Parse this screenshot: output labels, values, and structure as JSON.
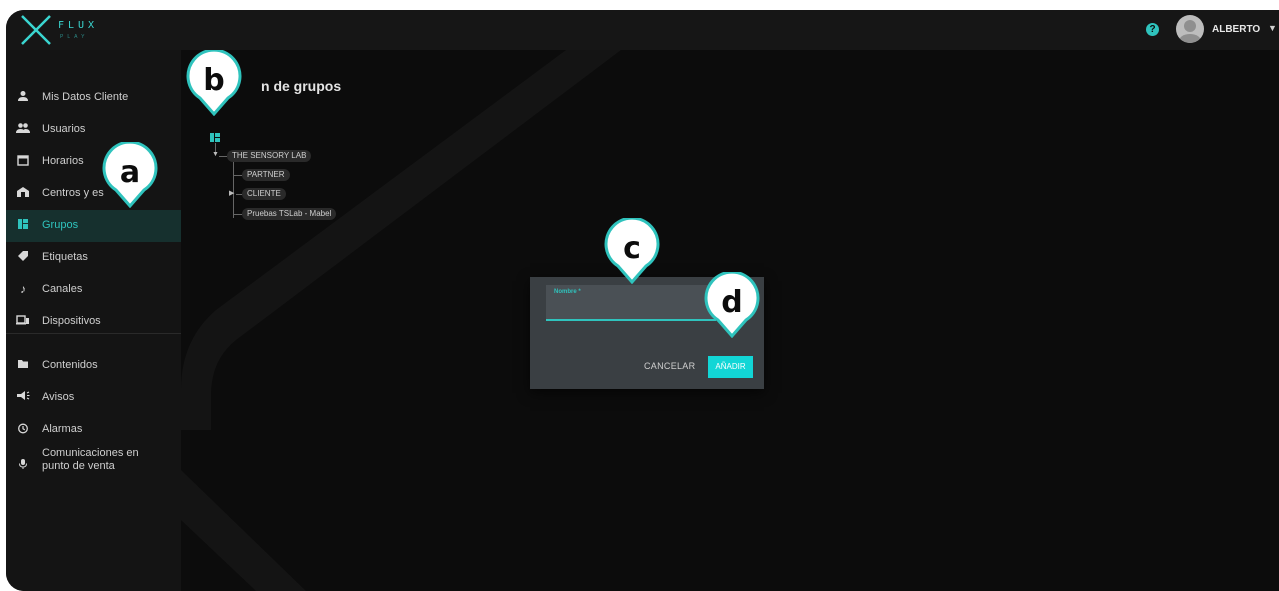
{
  "header": {
    "logo_text": "FLUX",
    "logo_sub": "PLAY",
    "help_icon": "help-icon",
    "user_name": "ALBERTO",
    "accent": "#2fc3bd"
  },
  "sidebar": {
    "items": [
      {
        "label": "Mis Datos Cliente",
        "icon": "person-icon"
      },
      {
        "label": "Usuarios",
        "icon": "users-icon"
      },
      {
        "label": "Horarios",
        "icon": "calendar-icon"
      },
      {
        "label": "Centros y es",
        "icon": "store-icon"
      },
      {
        "label": "Grupos",
        "icon": "groups-icon"
      },
      {
        "label": "Etiquetas",
        "icon": "tag-icon"
      },
      {
        "label": "Canales",
        "icon": "music-note-icon"
      },
      {
        "label": "Dispositivos",
        "icon": "devices-icon"
      },
      {
        "label": "Contenidos",
        "icon": "folder-icon"
      },
      {
        "label": "Avisos",
        "icon": "megaphone-icon"
      },
      {
        "label": "Alarmas",
        "icon": "alarm-icon"
      },
      {
        "label_line1": "Comunicaciones en",
        "label_line2": "punto de venta",
        "icon": "microphone-icon"
      }
    ]
  },
  "main": {
    "title": "n de grupos",
    "tree": {
      "root": "THE SENSORY LAB",
      "children": [
        "PARTNER",
        "CLIENTE",
        "Pruebas TSLab - Mabel"
      ]
    }
  },
  "dialog": {
    "field_label": "Nombre *",
    "cancel_label": "CANCELAR",
    "add_label": "AÑADIR"
  },
  "markers": [
    "a",
    "b",
    "c",
    "d"
  ]
}
